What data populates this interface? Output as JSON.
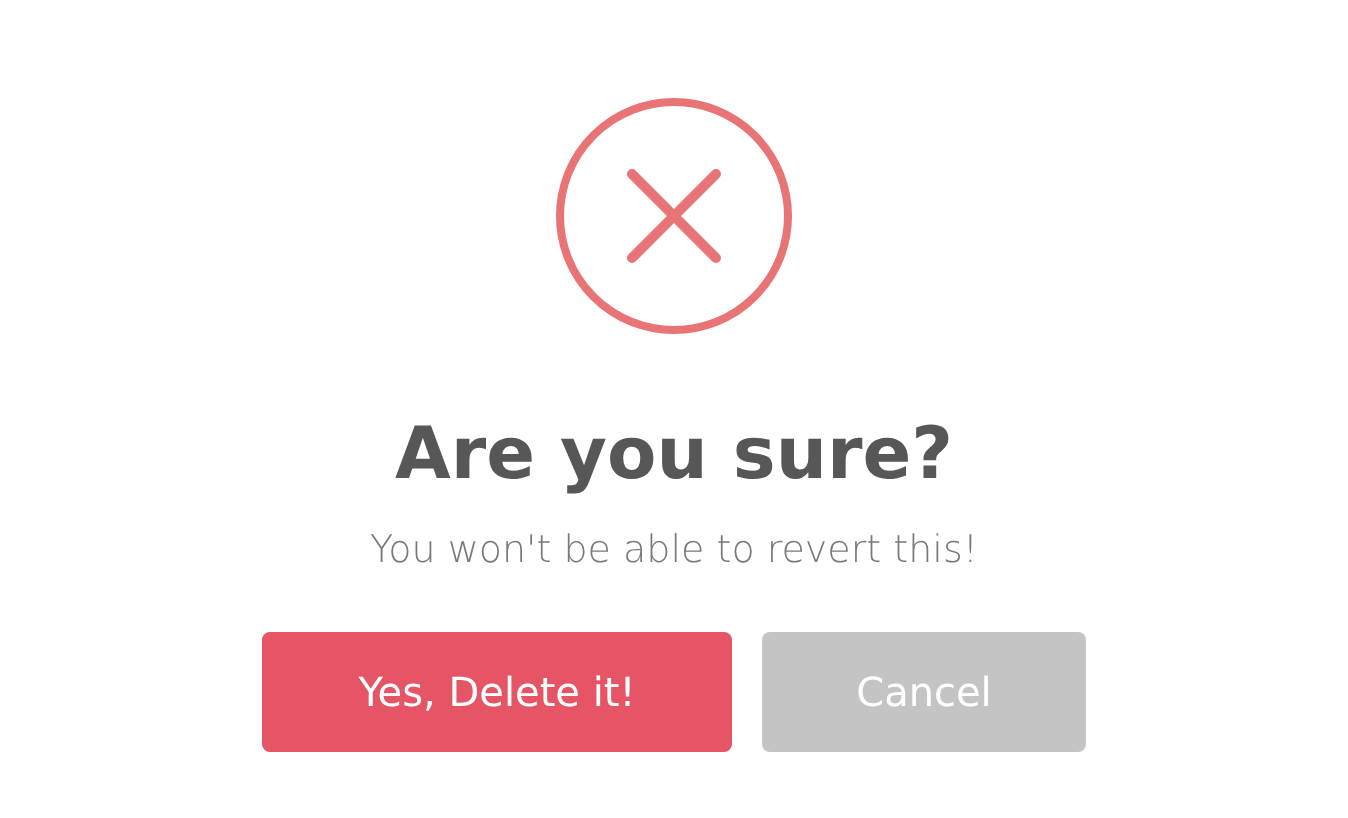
{
  "dialog": {
    "title": "Are you sure?",
    "message": "You won't be able to revert this!",
    "buttons": [
      {
        "label": "Yes, Delete it!",
        "kind": "confirm"
      },
      {
        "label": "Cancel",
        "kind": "cancel"
      }
    ]
  }
}
